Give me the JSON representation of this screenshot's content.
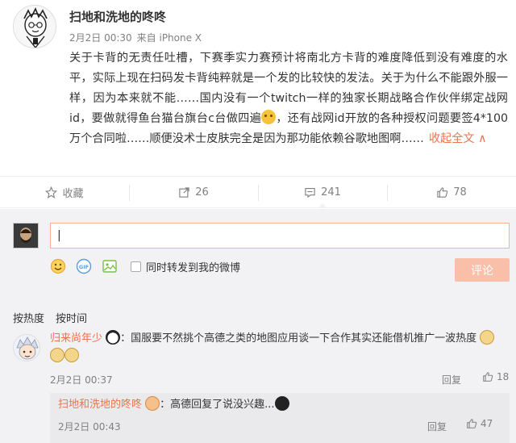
{
  "post": {
    "author": "扫地和洗地的咚咚",
    "date": "2月2日 00:30",
    "source": "来自 iPhone X",
    "body_before_emoji": "关于卡背的无责任吐槽，下赛季实力赛预计将南北方卡背的难度降低到没有难度的水平，实际上现在扫码发卡背纯粹就是一个发的比较快的发法。关于为什么不能跟外服一样，因为本来就不能……国内没有一个twitch一样的独家长期战略合作伙伴绑定战网id，要做就得鱼台猫台旗台c台做四遍",
    "body_after_emoji": "，还有战网id开放的各种授权问题要签4*100万个合同啦……顺便没术士皮肤完全是因为那功能依赖谷歌地图啊……",
    "collapse_label": "收起全文 ∧"
  },
  "actions": {
    "favorite": "收藏",
    "repost": "26",
    "comment": "241",
    "like": "78"
  },
  "composer": {
    "input_value": "|",
    "forward_label": "同时转发到我的微博",
    "submit_label": "评论"
  },
  "sort": {
    "by_hot": "按热度",
    "by_time": "按时间"
  },
  "comment": {
    "user": "归来尚年少",
    "text": "国服要不然挑个高德之类的地图应用谈一下合作其实还能借机推广一波热度",
    "time": "2月2日 00:37",
    "reply_label": "回复",
    "likes": "18"
  },
  "reply": {
    "user": "扫地和洗地的咚咚",
    "text": "高德回复了说没兴趣...",
    "time": "2月2日 00:43",
    "reply_label": "回复",
    "likes": "47"
  },
  "colors": {
    "accent": "#eb7350",
    "panel_bg": "#f2f2f5",
    "submit_bg": "#f9bfa8"
  }
}
